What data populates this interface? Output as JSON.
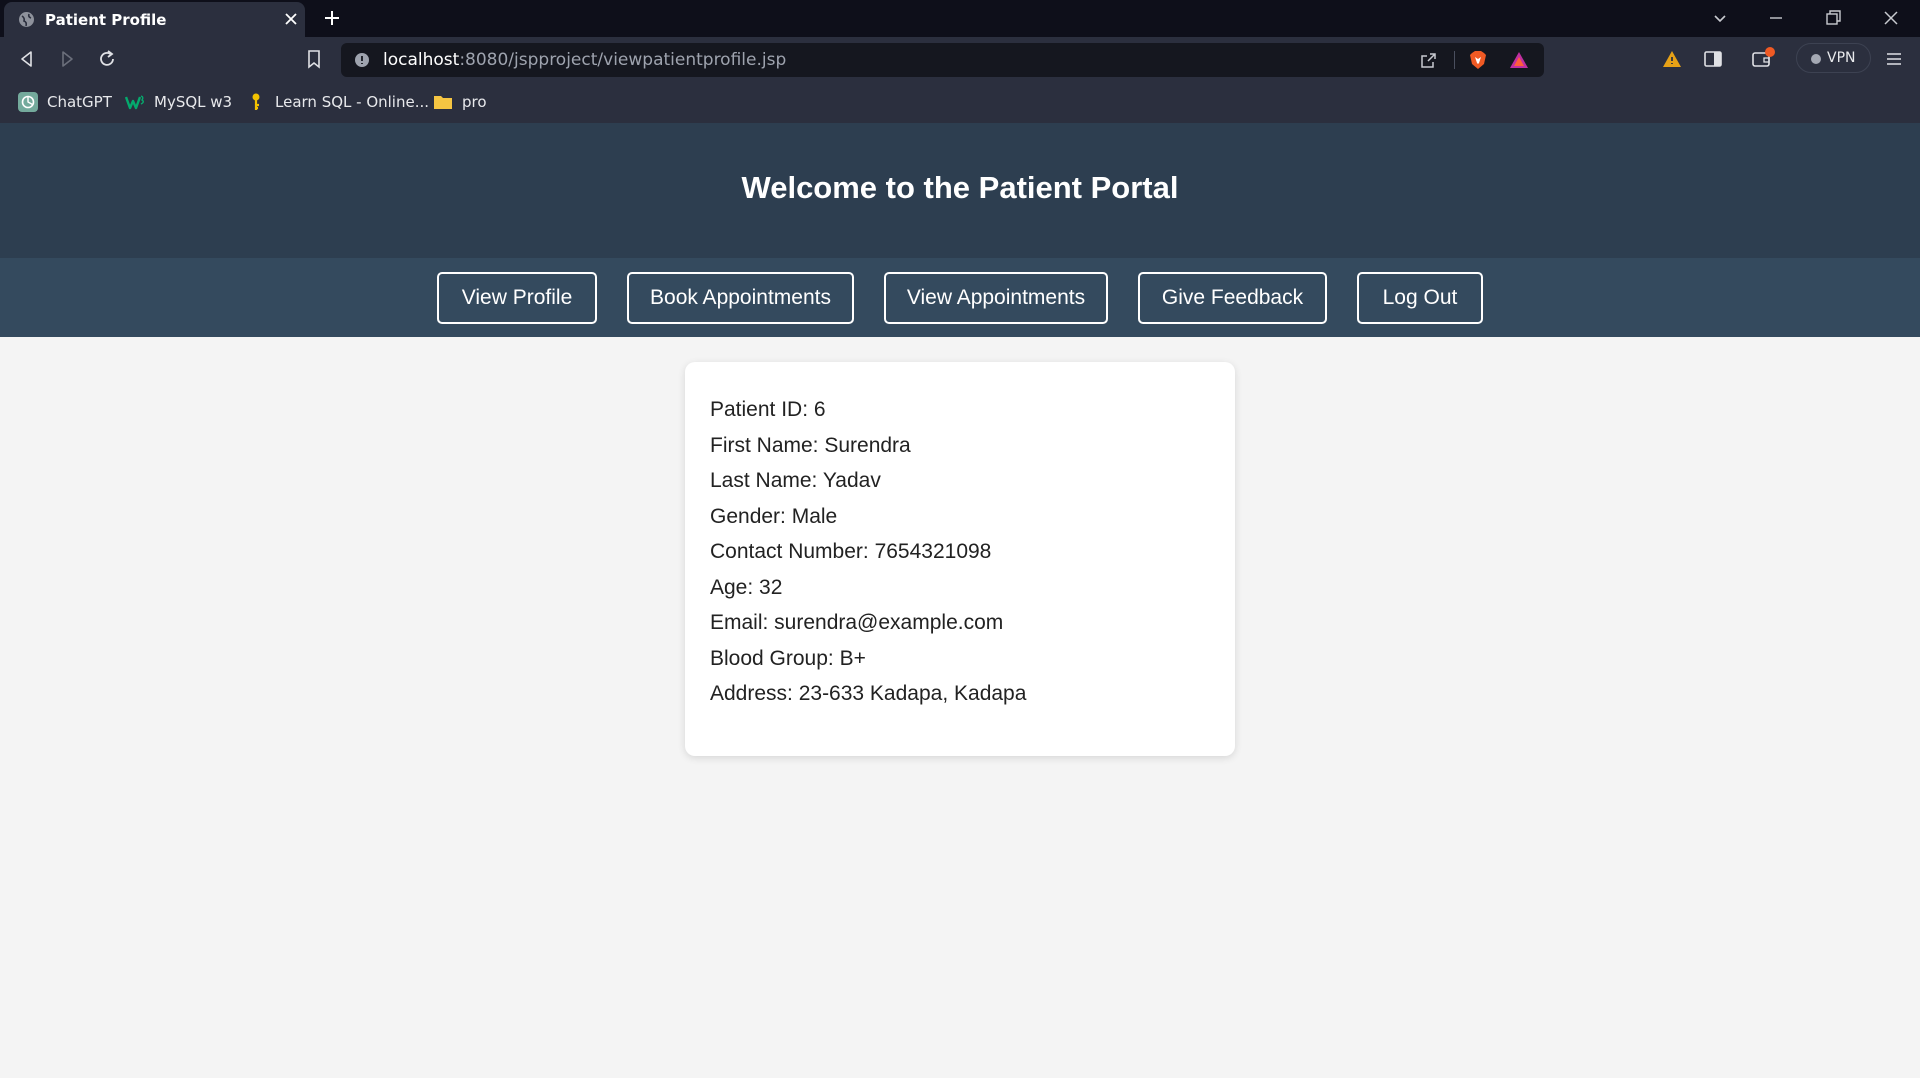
{
  "browser": {
    "tab_title": "Patient Profile",
    "url_host": "localhost",
    "url_rest": ":8080/jspproject/viewpatientprofile.jsp",
    "vpn_label": "VPN",
    "bookmarks": [
      {
        "label": "ChatGPT",
        "icon": "chatgpt-icon"
      },
      {
        "label": "MySQL w3",
        "icon": "w3schools-icon"
      },
      {
        "label": "Learn SQL - Online...",
        "icon": "key-icon"
      },
      {
        "label": "pro",
        "icon": "folder-icon"
      }
    ]
  },
  "page": {
    "title": "Welcome to the Patient Portal",
    "nav": [
      "View Profile",
      "Book Appointments",
      "View Appointments",
      "Give Feedback",
      "Log Out"
    ],
    "profile": {
      "patient_id": "Patient ID: 6",
      "first_name": "First Name: Surendra",
      "last_name": "Last Name: Yadav",
      "gender": "Gender: Male",
      "contact": "Contact Number: 7654321098",
      "age": "Age: 32",
      "email": "Email: surendra@example.com",
      "blood_group": "Blood Group: B+",
      "address": "Address: 23-633 Kadapa, Kadapa"
    }
  },
  "colors": {
    "header_bg": "#2d3e50",
    "nav_bg": "#344a5e",
    "page_bg": "#f4f4f4"
  }
}
